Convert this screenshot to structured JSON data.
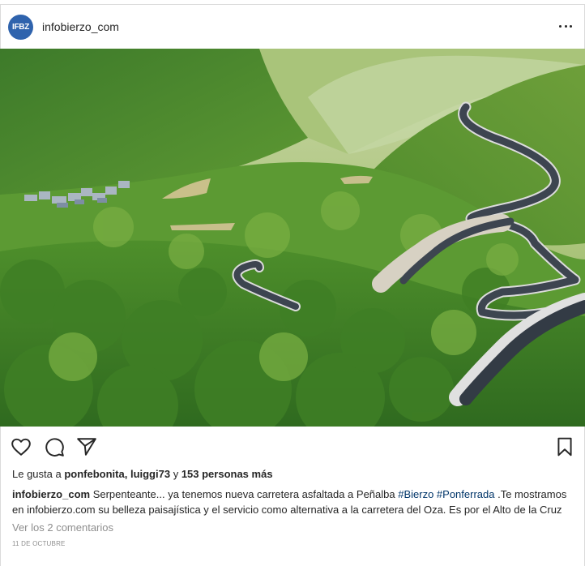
{
  "header": {
    "avatar_text": "IFBZ",
    "username": "infobierzo_com"
  },
  "photo": {
    "icon": "landscape-photo"
  },
  "actions": {
    "icons": [
      "heart-icon",
      "comment-icon",
      "share-icon",
      "bookmark-icon"
    ]
  },
  "likes": {
    "prefix": "Le gusta a ",
    "user1": "ponfebonita",
    "sep1": ", ",
    "user2": "luiggi73",
    "sep2": " y ",
    "others": "153 personas más"
  },
  "caption": {
    "username": "infobierzo_com",
    "text1": " Serpenteante... ya tenemos nueva carretera asfaltada a Peñalba ",
    "tag1": "#Bierzo",
    "space": " ",
    "tag2": "#Ponferrada",
    "text2": " .Te mostramos en infobierzo.com su belleza paisajística y el servicio como alternativa a la carretera del Oza. Es por el Alto de la Cruz"
  },
  "comments_link": "Ver los 2 comentarios",
  "date": "11 DE OCTUBRE",
  "colors": {
    "avatar_bg": "#2f63ad",
    "hashtag": "#003569",
    "muted": "#8e8e8e"
  }
}
